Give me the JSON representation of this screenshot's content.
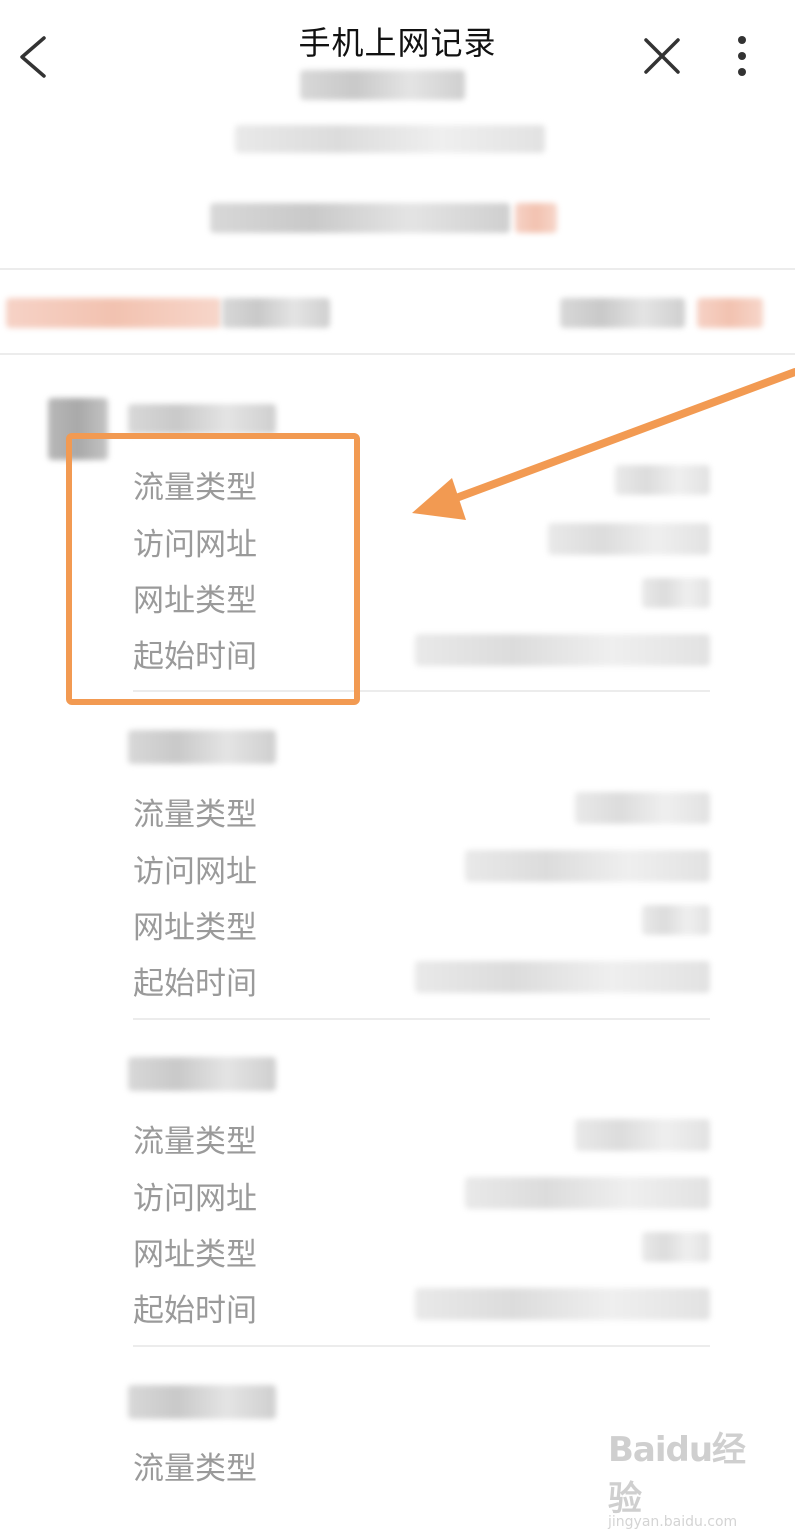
{
  "header": {
    "title": "手机上网记录",
    "back_icon": "chevron-left-icon",
    "close_icon": "close-icon",
    "more_icon": "more-vertical-icon"
  },
  "records": [
    {
      "fields": [
        {
          "label": "流量类型"
        },
        {
          "label": "访问网址"
        },
        {
          "label": "网址类型"
        },
        {
          "label": "起始时间"
        }
      ]
    },
    {
      "fields": [
        {
          "label": "流量类型"
        },
        {
          "label": "访问网址"
        },
        {
          "label": "网址类型"
        },
        {
          "label": "起始时间"
        }
      ]
    },
    {
      "fields": [
        {
          "label": "流量类型"
        },
        {
          "label": "访问网址"
        },
        {
          "label": "网址类型"
        },
        {
          "label": "起始时间"
        }
      ]
    },
    {
      "fields": [
        {
          "label": "流量类型"
        }
      ]
    }
  ],
  "annotation": {
    "color": "#f29a52"
  },
  "watermark": {
    "logo": "Baidu经验",
    "sub": "jingyan.baidu.com"
  }
}
